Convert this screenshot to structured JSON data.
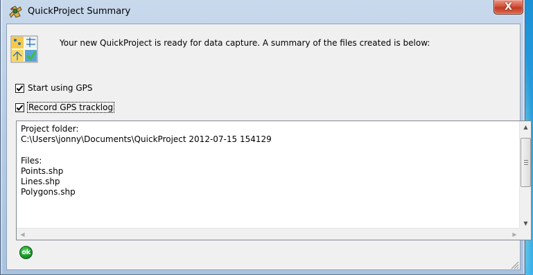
{
  "window": {
    "title": "QuickProject Summary",
    "close_symbol": "X"
  },
  "intro_text": "Your new QuickProject is ready for data capture. A summary of the files created is below:",
  "options": {
    "start_gps_label": "Start using GPS",
    "start_gps_checked": true,
    "record_tracklog_label": "Record GPS tracklog",
    "record_tracklog_checked": true
  },
  "summary": {
    "text": "Project folder:\nC:\\Users\\jonny\\Documents\\QuickProject 2012-07-15 154129\n\nFiles:\nPoints.shp\nLines.shp\nPolygons.shp"
  },
  "ok_button_label": "ok",
  "icons": {
    "title": "gps-tool-icon",
    "app": "quickproject-icon",
    "ok": "ok-circle-icon"
  }
}
